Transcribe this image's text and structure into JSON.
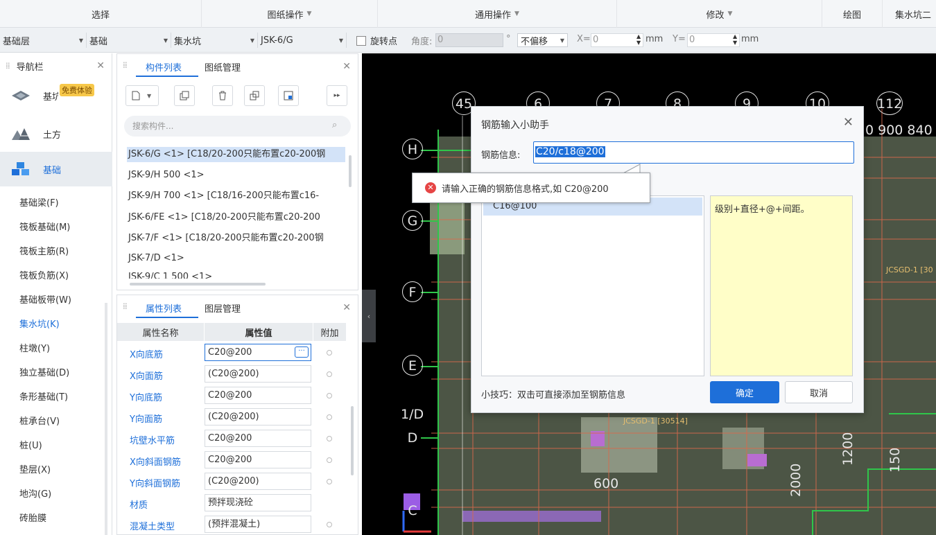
{
  "ribbon": {
    "groups": [
      "选择",
      "图纸操作",
      "通用操作",
      "修改",
      "绘图",
      "集水坑二"
    ]
  },
  "toolbar2": {
    "floor": "基础层",
    "category": "基础",
    "type": "集水坑",
    "component": "JSK-6/G",
    "rotate_label": "旋转点",
    "angle_label": "角度:",
    "angle_value": "0",
    "degree": "°",
    "offset": "不偏移",
    "x_label": "X=",
    "x_value": "0",
    "y_label": "Y=",
    "y_value": "0",
    "mm": "mm"
  },
  "nav": {
    "title": "导航栏",
    "badge": "免费体验",
    "big_items": [
      "基坑支护",
      "土方",
      "基础"
    ],
    "items": [
      "基础梁(F)",
      "筏板基础(M)",
      "筏板主筋(R)",
      "筏板负筋(X)",
      "基础板带(W)",
      "集水坑(K)",
      "柱墩(Y)",
      "独立基础(D)",
      "条形基础(T)",
      "桩承台(V)",
      "桩(U)",
      "垫层(X)",
      "地沟(G)",
      "砖胎膜"
    ]
  },
  "comp": {
    "tab_active": "构件列表",
    "tab_other": "图纸管理",
    "search_placeholder": "搜索构件...",
    "list": [
      "JSK-6/G <1> [C18/20-200只能布置c20-200钢",
      "JSK-9/H 500 <1>",
      "JSK-9/H 700 <1> [C18/16-200只能布置c16-",
      "JSK-6/FE <1> [C18/20-200只能布置c20-200",
      "JSK-7/F <1> [C18/20-200只能布置c20-200钢",
      "JSK-7/D <1>",
      "JSK-9/C 1 500 <1>"
    ]
  },
  "props": {
    "tab_active": "属性列表",
    "tab_other": "图层管理",
    "col_name": "属性名称",
    "col_value": "属性值",
    "col_extra": "附加",
    "rows": [
      {
        "name": "X向底筋",
        "value": "C20@200"
      },
      {
        "name": "X向面筋",
        "value": "(C20@200)"
      },
      {
        "name": "Y向底筋",
        "value": "C20@200"
      },
      {
        "name": "Y向面筋",
        "value": "(C20@200)"
      },
      {
        "name": "坑壁水平筋",
        "value": "C20@200"
      },
      {
        "name": "X向斜面钢筋",
        "value": "C20@200"
      },
      {
        "name": "Y向斜面钢筋",
        "value": "(C20@200)"
      },
      {
        "name": "材质",
        "value": "预拌现浇砼"
      },
      {
        "name": "混凝土类型",
        "value": "(预拌混凝土)"
      }
    ]
  },
  "canvas": {
    "axis_top": [
      "45",
      "6",
      "7",
      "8",
      "9",
      "10",
      "112"
    ],
    "axis_left": [
      "H",
      "G",
      "F",
      "E",
      "1/D",
      "D",
      "C"
    ],
    "dims": [
      "0 900 840",
      "600",
      "1200",
      "150",
      "2000"
    ],
    "labels": [
      "JCSGD-1 [30514]",
      "JCSGD-1 [30"
    ]
  },
  "dialog": {
    "title": "钢筋输入小助手",
    "field_label": "钢筋信息:",
    "field_value": "C20/c18@200",
    "list_item": "C16@100",
    "hint": "级别+直径+@+间距。",
    "tip": "小技巧：双击可直接添加至钢筋信息",
    "ok": "确定",
    "cancel": "取消"
  },
  "error_tip": "请输入正确的钢筋信息格式,如 C20@200"
}
